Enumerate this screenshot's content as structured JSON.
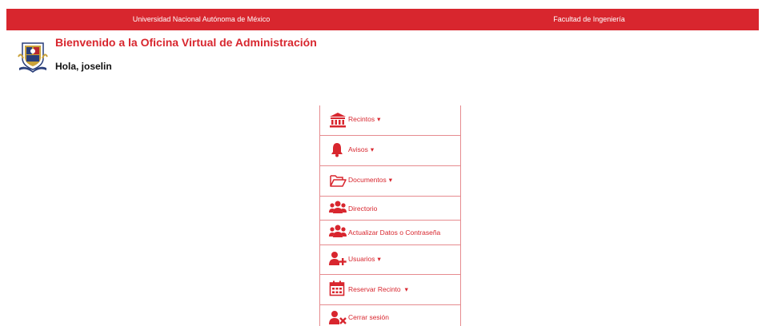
{
  "header": {
    "left_text": "Universidad Nacional Autónoma de México",
    "right_text": "Facultad de Ingeniería"
  },
  "page": {
    "welcome": "Bienvenido a la Oficina Virtual de Administración",
    "greeting": "Hola, joselin"
  },
  "menu": {
    "items": [
      {
        "label": "Recintos",
        "caret": "▾",
        "icon": "building-icon"
      },
      {
        "label": "Avisos",
        "caret": "▾",
        "icon": "bell-icon"
      },
      {
        "label": "Documentos",
        "caret": "▾",
        "icon": "folder-open-icon"
      },
      {
        "label": "Directorio",
        "icon": "users-icon"
      },
      {
        "label": "Actualizar Datos o Contraseña",
        "icon": "users-icon"
      },
      {
        "label": "Usuarios",
        "caret": "▾",
        "icon": "user-plus-icon"
      },
      {
        "label": "Reservar Recinto",
        "caret": "▾",
        "icon": "calendar-icon"
      },
      {
        "label": "Cerrar sesión",
        "icon": "user-times-icon"
      }
    ]
  },
  "colors": {
    "brand_red": "#d8262e",
    "border": "#e68b8f"
  }
}
